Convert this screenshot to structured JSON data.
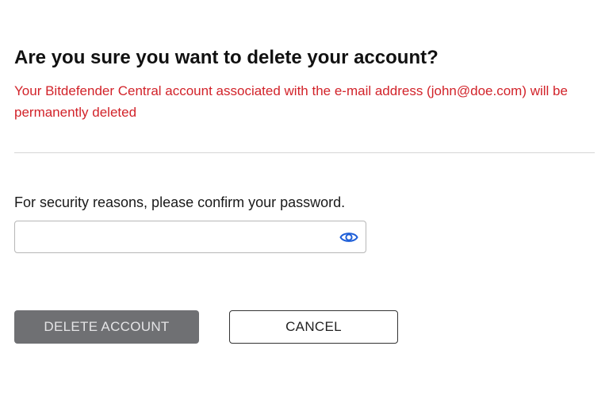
{
  "dialog": {
    "title": "Are you sure you want to delete your account?",
    "warning": "Your Bitdefender Central account associated with the e-mail address (john@doe.com) will be permanently deleted",
    "prompt": "For security reasons, please confirm your password.",
    "password_field": {
      "value": "",
      "placeholder": "",
      "toggle_icon": "eye-icon"
    },
    "buttons": {
      "delete_label": "DELETE ACCOUNT",
      "cancel_label": "CANCEL"
    }
  },
  "colors": {
    "warning_text": "#d2232a",
    "delete_button_bg": "#6f7073",
    "eye_icon": "#1f5fd8"
  }
}
